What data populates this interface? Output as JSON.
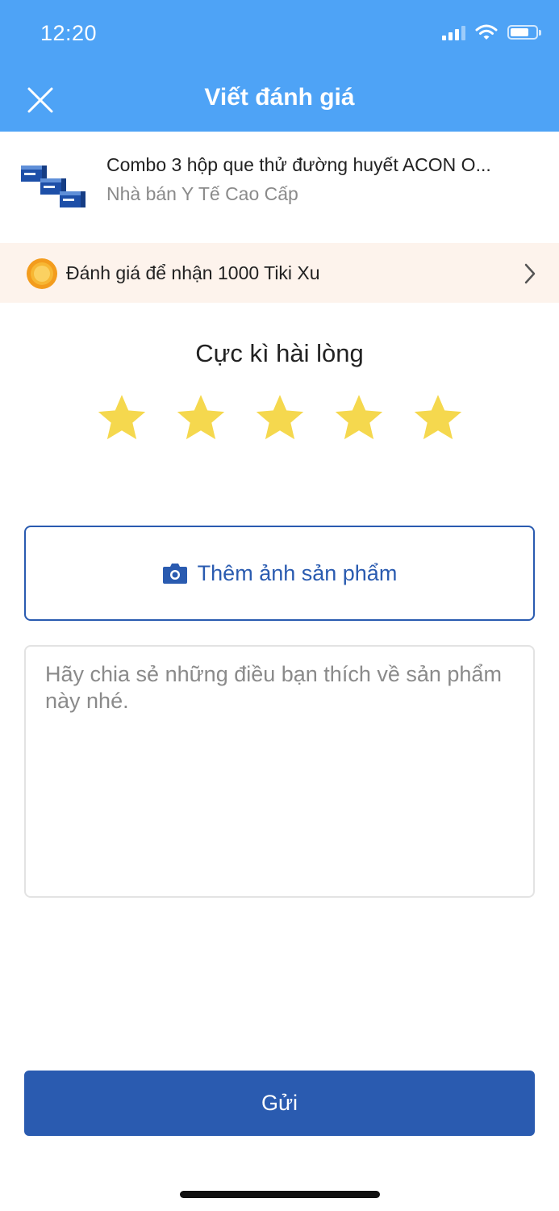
{
  "status_bar": {
    "time": "12:20",
    "battery_level": 0.7
  },
  "header": {
    "title": "Viết đánh giá",
    "close_icon": "close-icon"
  },
  "product": {
    "name": "Combo 3 hộp que thử đường huyết ACON O...",
    "seller": "Nhà bán Y Tế Cao Cấp"
  },
  "reward": {
    "text": "Đánh giá để nhận 1000 Tiki Xu",
    "icon": "coin-icon"
  },
  "rating": {
    "label": "Cực kì hài lòng",
    "stars": 5,
    "max_stars": 5,
    "star_color": "#f5d84e"
  },
  "photo": {
    "label": "Thêm ảnh sản phẩm",
    "icon": "camera-icon"
  },
  "review": {
    "placeholder": "Hãy chia sẻ những điều bạn thích về sản phẩm này nhé.",
    "value": ""
  },
  "submit": {
    "label": "Gửi"
  },
  "colors": {
    "header": "#4ea3f6",
    "primary": "#2a5bb0",
    "reward_bg": "#fdf3ec"
  }
}
